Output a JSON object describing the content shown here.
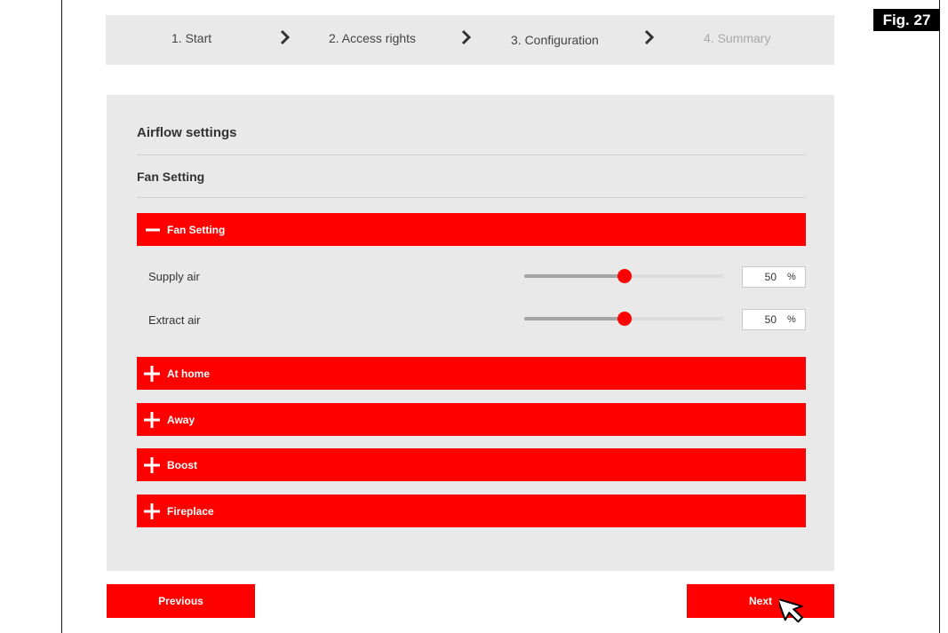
{
  "figure_label": "Fig. 27",
  "wizard": {
    "steps": [
      {
        "label": "1. Start",
        "state": "done"
      },
      {
        "label": "2. Access rights",
        "state": "done"
      },
      {
        "label": "3. Configuration",
        "state": "active"
      },
      {
        "label": "4. Summary",
        "state": "disabled"
      }
    ],
    "separator_icon": "chevron-right-icon"
  },
  "panel": {
    "title": "Airflow settings",
    "section_title": "Fan Setting",
    "accordions": [
      {
        "label": "Fan Setting",
        "expanded": true,
        "icon": "minus-icon",
        "rows": [
          {
            "label": "Supply air",
            "value": "50",
            "unit": "%",
            "level": 0.5
          },
          {
            "label": "Extract air",
            "value": "50",
            "unit": "%",
            "level": 0.5
          }
        ]
      },
      {
        "label": "At home",
        "expanded": false,
        "icon": "plus-icon"
      },
      {
        "label": "Away",
        "expanded": false,
        "icon": "plus-icon"
      },
      {
        "label": "Boost",
        "expanded": false,
        "icon": "plus-icon"
      },
      {
        "label": "Fireplace",
        "expanded": false,
        "icon": "plus-icon"
      }
    ]
  },
  "footer": {
    "previous_label": "Previous",
    "next_label": "Next"
  },
  "colors": {
    "accent": "#ff0000",
    "panel_bg": "#e9e9e9",
    "slider_fill": "#a3a3a3",
    "slider_track": "#dcdcdc"
  }
}
